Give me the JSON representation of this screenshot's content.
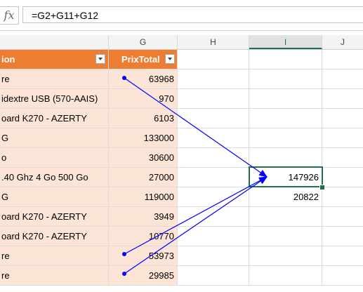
{
  "formula_bar": {
    "fx_label": "fx",
    "formula": "=G2+G11+G12"
  },
  "columns": {
    "G": "G",
    "H": "H",
    "I": "I",
    "J": "J"
  },
  "table": {
    "header_description": "ion",
    "header_prixtotal": "PrixTotal",
    "rows": [
      {
        "description": "re",
        "prixtotal": "63968"
      },
      {
        "description": "idextre USB (570-AAIS)",
        "prixtotal": "970"
      },
      {
        "description": "oard K270 - AZERTY",
        "prixtotal": "6103"
      },
      {
        "description": "G",
        "prixtotal": "133000"
      },
      {
        "description": "o",
        "prixtotal": "30600"
      },
      {
        "description": ".40 Ghz 4 Go 500 Go",
        "prixtotal": "27000"
      },
      {
        "description": "G",
        "prixtotal": "119000"
      },
      {
        "description": "oard K270 - AZERTY",
        "prixtotal": "3949"
      },
      {
        "description": "oard K270 - AZERTY",
        "prixtotal": "10770"
      },
      {
        "description": "re",
        "prixtotal": "53973"
      },
      {
        "description": "re",
        "prixtotal": "29985"
      }
    ]
  },
  "column_i": {
    "i7_value": "147926",
    "i8_value": "20822"
  },
  "colors": {
    "header_orange": "#ed7d31",
    "row_peach": "#fce4d6",
    "selection_green": "#217346",
    "trace_arrow_blue": "#0000ff"
  },
  "icons": [
    "fx-icon",
    "filter-dropdown-icon",
    "trace-precedents-arrow"
  ]
}
